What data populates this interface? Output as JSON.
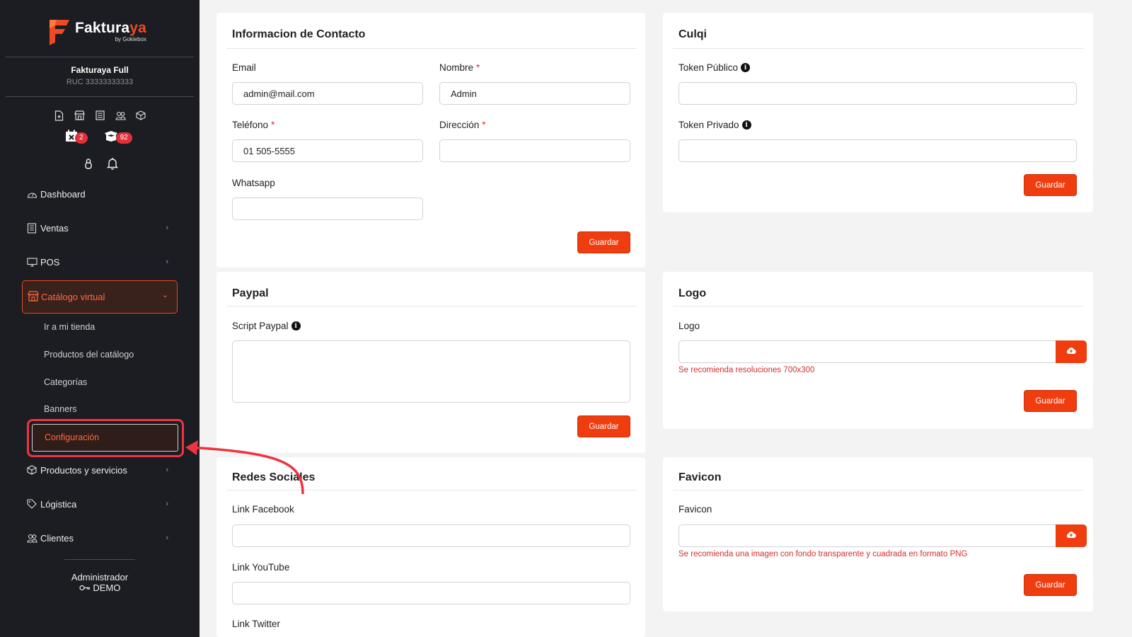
{
  "brand": {
    "name_prefix": "Faktura",
    "name_accent": "ya",
    "tagline": "by Gokiebox",
    "accent_color": "#ef3d0f"
  },
  "company": {
    "name": "Fakturaya Full",
    "ruc": "RUC 33333333333"
  },
  "badges": {
    "calendar_count": "2",
    "boxes_count": "92"
  },
  "sidebar": {
    "nav": [
      {
        "label": "Dashboard",
        "icon": "dashboard-icon"
      },
      {
        "label": "Ventas",
        "icon": "receipt-icon"
      },
      {
        "label": "POS",
        "icon": "monitor-icon"
      },
      {
        "label": "Catálogo virtual",
        "icon": "store-icon"
      },
      {
        "label": "Productos y servicios",
        "icon": "box-icon"
      },
      {
        "label": "Lógistica",
        "icon": "tag-icon"
      },
      {
        "label": "Clientes",
        "icon": "users-icon"
      }
    ],
    "sub_items": [
      {
        "label": "Ir a mi tienda"
      },
      {
        "label": "Productos del catálogo"
      },
      {
        "label": "Categorías"
      },
      {
        "label": "Banners"
      },
      {
        "label": "Configuración"
      }
    ],
    "footer": {
      "role": "Administrador",
      "user": "DEMO"
    }
  },
  "contact": {
    "title": "Informacion de Contacto",
    "email_label": "Email",
    "email_value": "admin@mail.com",
    "nombre_label": "Nombre",
    "nombre_value": "Admin",
    "telefono_label": "Teléfono",
    "telefono_value": "01 505-5555",
    "direccion_label": "Dirección",
    "direccion_value": "",
    "whatsapp_label": "Whatsapp",
    "whatsapp_value": "",
    "required_mark": "*",
    "save_label": "Guardar"
  },
  "culqi": {
    "title": "Culqi",
    "public_label": "Token Público",
    "private_label": "Token Privado",
    "save_label": "Guardar"
  },
  "paypal": {
    "title": "Paypal",
    "script_label": "Script Paypal",
    "save_label": "Guardar"
  },
  "logo": {
    "title": "Logo",
    "field_label": "Logo",
    "hint": "Se recomienda resoluciones 700x300",
    "save_label": "Guardar"
  },
  "social": {
    "title": "Redes Sociales",
    "facebook_label": "Link Facebook",
    "youtube_label": "Link YouTube",
    "twitter_label": "Link Twitter"
  },
  "favicon": {
    "title": "Favicon",
    "field_label": "Favicon",
    "hint": "Se recomienda una imagen con fondo transparente y cuadrada en formato PNG",
    "save_label": "Guardar"
  },
  "info_glyph": "i",
  "chevron_glyph": "›",
  "chevron_down_glyph": "⌄"
}
